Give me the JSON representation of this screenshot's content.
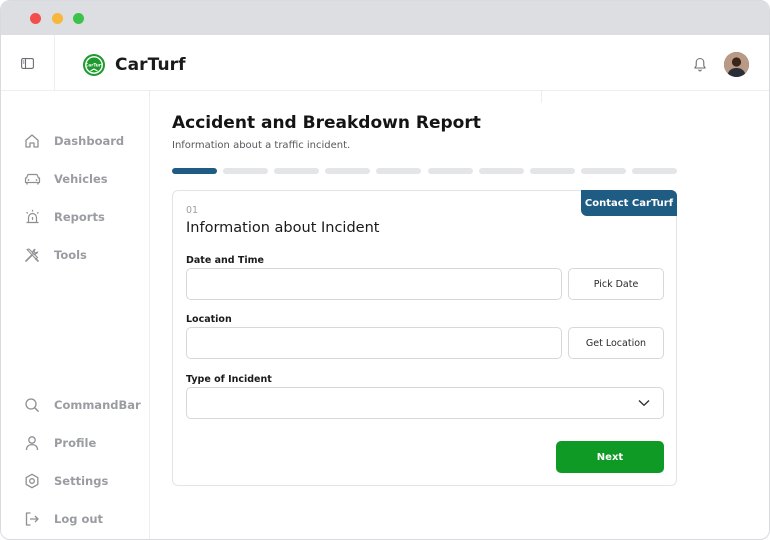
{
  "app": {
    "name": "CarTurf"
  },
  "sidebar": {
    "top_items": [
      {
        "label": "Dashboard",
        "icon": "home-icon"
      },
      {
        "label": "Vehicles",
        "icon": "car-icon"
      },
      {
        "label": "Reports",
        "icon": "siren-icon"
      },
      {
        "label": "Tools",
        "icon": "tools-icon"
      }
    ],
    "bottom_items": [
      {
        "label": "CommandBar",
        "icon": "search-icon"
      },
      {
        "label": "Profile",
        "icon": "user-icon"
      },
      {
        "label": "Settings",
        "icon": "hexagon-settings-icon"
      },
      {
        "label": "Log out",
        "icon": "logout-icon"
      }
    ]
  },
  "page": {
    "title": "Accident and Breakdown Report",
    "subtitle": "Information about a traffic incident.",
    "progress": {
      "total_steps": 10,
      "current_step": 1
    }
  },
  "form": {
    "contact_label": "Contact CarTurf",
    "step_number": "01",
    "section_title": "Information about Incident",
    "date_time": {
      "label": "Date and Time",
      "value": "",
      "button": "Pick Date"
    },
    "location": {
      "label": "Location",
      "value": "",
      "button": "Get Location"
    },
    "incident_type": {
      "label": "Type of Incident",
      "value": ""
    },
    "next_label": "Next"
  },
  "colors": {
    "accent_blue": "#1e5c84",
    "next_green": "#0f9a25",
    "logo_green": "#1f9a2e"
  }
}
